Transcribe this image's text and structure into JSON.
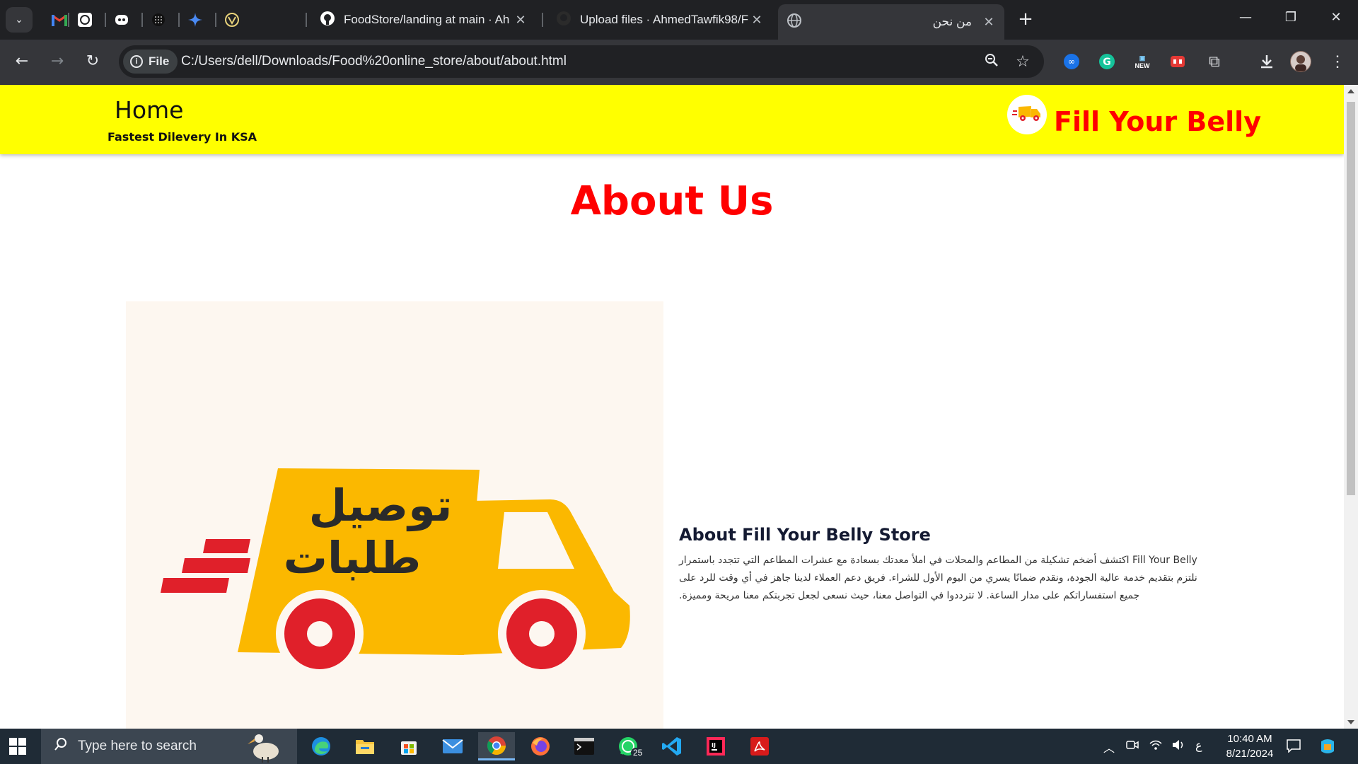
{
  "browser": {
    "tabs": [
      {
        "title": "FoodStore/landing at main · Ah",
        "active": false
      },
      {
        "title": "Upload files · AhmedTawfik98/F",
        "active": false
      },
      {
        "title": "من نحن",
        "active": true
      }
    ],
    "pinned_icons": [
      "gmail-icon",
      "chatgpt-icon",
      "copilot-icon",
      "perplexity-icon",
      "gemini-icon",
      "vercel-icon"
    ],
    "url_chip": "File",
    "url": "C:/Users/dell/Downloads/Food%20online_store/about/about.html",
    "ext_new_label": "NEW"
  },
  "site": {
    "nav_home": "Home",
    "tagline": "Fastest Dilevery In KSA",
    "brand": "Fill Your Belly",
    "page_title": "About Us",
    "hero_line1": "توصيل",
    "hero_line2": "طلبات",
    "info_title": "About Fill Your Belly Store",
    "info_text": "Fill Your Belly اكتشف أضخم تشكيلة من المطاعم والمحلات في املأ معدتك بسعادة مع عشرات المطاعم التي تتجدد باستمرار نلتزم بتقديم خدمة عالية الجودة، ونقدم ضمانًا يسري من اليوم الأول للشراء. فريق دعم العملاء لدينا جاهز في أي وقت للرد على جميع استفساراتكم على مدار الساعة. لا تترددوا في التواصل معنا، حيث نسعى لجعل تجربتكم معنا مريحة ومميزة."
  },
  "taskbar": {
    "search_placeholder": "Type here to search",
    "whatsapp_badge": "25",
    "lang": "ع",
    "time": "10:40 AM",
    "date": "8/21/2024"
  },
  "colors": {
    "header_bg": "#ffff00",
    "accent_red": "#ff0000",
    "truck_yellow": "#fbb800",
    "wheel_red": "#e0202a"
  }
}
